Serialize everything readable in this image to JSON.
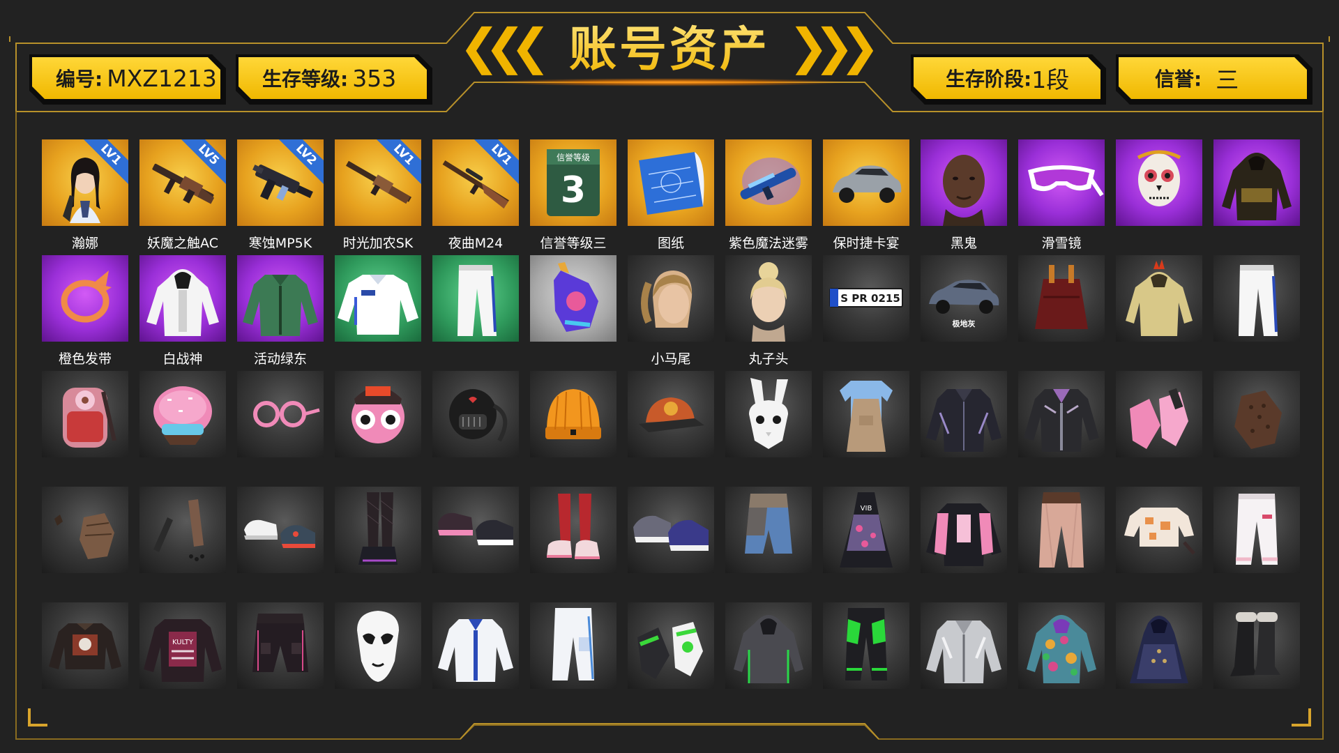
{
  "title": "账号资产",
  "badges": {
    "id": {
      "label": "编号:",
      "value": "MXZ1213"
    },
    "level": {
      "label": "生存等级:",
      "value": "353"
    },
    "stage": {
      "label": "生存阶段:",
      "value": "1段"
    },
    "honor": {
      "label": "信誉:",
      "value": "三"
    }
  },
  "rank_card": {
    "title": "信誉等级",
    "number": "3"
  },
  "plate_text": "S PR 0215",
  "car_caption": "极地灰",
  "colors": {
    "gold": "#f0b800",
    "purple": "#9a2fd8",
    "frame": "#b8912a",
    "lv_badge": "#2f6fd6"
  },
  "rows": [
    [
      {
        "label": "瀚娜",
        "lv": "LV1",
        "bg": "gold",
        "icon": "female-character-icon"
      },
      {
        "label": "妖魔之触AC",
        "lv": "LV5",
        "bg": "gold",
        "icon": "rifle-icon"
      },
      {
        "label": "寒蚀MP5K",
        "lv": "LV2",
        "bg": "gold",
        "icon": "smg-icon"
      },
      {
        "label": "时光加农SK",
        "lv": "LV1",
        "bg": "gold",
        "icon": "shotgun-rifle-icon"
      },
      {
        "label": "夜曲M24",
        "lv": "LV1",
        "bg": "gold",
        "icon": "sniper-rifle-icon"
      },
      {
        "label": "信誉等级三",
        "lv": "",
        "bg": "gold",
        "icon": "honor-rank-icon"
      },
      {
        "label": "图纸",
        "lv": "",
        "bg": "gold",
        "icon": "blueprint-icon"
      },
      {
        "label": "紫色魔法迷雾",
        "lv": "",
        "bg": "gold",
        "icon": "magic-mist-gun-icon"
      },
      {
        "label": "保时捷卡宴",
        "lv": "",
        "bg": "gold",
        "icon": "car-icon"
      },
      {
        "label": "黑鬼",
        "lv": "",
        "bg": "purple",
        "icon": "male-head-icon"
      },
      {
        "label": "滑雪镜",
        "lv": "",
        "bg": "purple",
        "icon": "ski-goggles-icon"
      },
      {
        "label": "",
        "lv": "",
        "bg": "purple",
        "icon": "skull-mask-icon"
      },
      {
        "label": "",
        "lv": "",
        "bg": "purple",
        "icon": "hooded-jacket-icon"
      }
    ],
    [
      {
        "label": "橙色发带",
        "lv": "",
        "bg": "purple",
        "icon": "headband-icon"
      },
      {
        "label": "白战神",
        "lv": "",
        "bg": "purple",
        "icon": "white-hoodie-icon"
      },
      {
        "label": "活动绿东",
        "lv": "",
        "bg": "purple",
        "icon": "green-jacket-icon"
      },
      {
        "label": "",
        "lv": "",
        "bg": "green",
        "icon": "white-shirt-icon"
      },
      {
        "label": "",
        "lv": "",
        "bg": "green",
        "icon": "white-pants-icon"
      },
      {
        "label": "",
        "lv": "",
        "bg": "gray",
        "icon": "glove-icon"
      },
      {
        "label": "小马尾",
        "lv": "",
        "bg": "dark",
        "icon": "ponytail-hair-icon"
      },
      {
        "label": "丸子头",
        "lv": "",
        "bg": "dark",
        "icon": "bun-hair-icon"
      },
      {
        "label": "",
        "lv": "",
        "bg": "dark",
        "icon": "license-plate-icon"
      },
      {
        "label": "",
        "lv": "",
        "bg": "dark",
        "icon": "suv-icon"
      },
      {
        "label": "",
        "lv": "",
        "bg": "dark",
        "icon": "red-top-icon"
      },
      {
        "label": "",
        "lv": "",
        "bg": "dark",
        "icon": "chicken-hoodie-icon"
      },
      {
        "label": "",
        "lv": "",
        "bg": "dark",
        "icon": "white-pants-icon"
      }
    ],
    [
      {
        "label": "",
        "lv": "",
        "bg": "dark",
        "icon": "donut-backpack-icon"
      },
      {
        "label": "",
        "lv": "",
        "bg": "dark",
        "icon": "donut-helmet-icon"
      },
      {
        "label": "",
        "lv": "",
        "bg": "dark",
        "icon": "pink-glasses-icon"
      },
      {
        "label": "",
        "lv": "",
        "bg": "dark",
        "icon": "donut-head-icon"
      },
      {
        "label": "",
        "lv": "",
        "bg": "dark",
        "icon": "black-mask-icon"
      },
      {
        "label": "",
        "lv": "",
        "bg": "dark",
        "icon": "orange-beanie-icon"
      },
      {
        "label": "",
        "lv": "",
        "bg": "dark",
        "icon": "cap-icon"
      },
      {
        "label": "",
        "lv": "",
        "bg": "dark",
        "icon": "rabbit-mask-icon"
      },
      {
        "label": "",
        "lv": "",
        "bg": "dark",
        "icon": "apron-icon"
      },
      {
        "label": "",
        "lv": "",
        "bg": "dark",
        "icon": "dark-jacket-icon"
      },
      {
        "label": "",
        "lv": "",
        "bg": "dark",
        "icon": "leather-jacket-icon"
      },
      {
        "label": "",
        "lv": "",
        "bg": "dark",
        "icon": "pink-gloves-icon"
      },
      {
        "label": "",
        "lv": "",
        "bg": "dark",
        "icon": "lace-glove-icon"
      }
    ],
    [
      {
        "label": "",
        "lv": "",
        "bg": "dark",
        "icon": "brown-glove-icon"
      },
      {
        "label": "",
        "lv": "",
        "bg": "dark",
        "icon": "arm-wrap-icon"
      },
      {
        "label": "",
        "lv": "",
        "bg": "dark",
        "icon": "sneakers-icon"
      },
      {
        "label": "",
        "lv": "",
        "bg": "dark",
        "icon": "stockings-boots-icon"
      },
      {
        "label": "",
        "lv": "",
        "bg": "dark",
        "icon": "pink-sneakers-icon"
      },
      {
        "label": "",
        "lv": "",
        "bg": "dark",
        "icon": "red-socks-shoes-icon"
      },
      {
        "label": "",
        "lv": "",
        "bg": "dark",
        "icon": "sport-shoes-icon"
      },
      {
        "label": "",
        "lv": "",
        "bg": "dark",
        "icon": "denim-shorts-icon"
      },
      {
        "label": "",
        "lv": "",
        "bg": "dark",
        "icon": "dress-icon"
      },
      {
        "label": "",
        "lv": "",
        "bg": "dark",
        "icon": "pink-jacket-icon"
      },
      {
        "label": "",
        "lv": "",
        "bg": "dark",
        "icon": "beige-pants-icon"
      },
      {
        "label": "",
        "lv": "",
        "bg": "dark",
        "icon": "crop-top-icon"
      },
      {
        "label": "",
        "lv": "",
        "bg": "dark",
        "icon": "white-joggers-icon"
      }
    ],
    [
      {
        "label": "",
        "lv": "",
        "bg": "dark",
        "icon": "crop-hoodie-icon"
      },
      {
        "label": "",
        "lv": "",
        "bg": "dark",
        "icon": "print-sweater-icon"
      },
      {
        "label": "",
        "lv": "",
        "bg": "dark",
        "icon": "cargo-shorts-icon"
      },
      {
        "label": "",
        "lv": "",
        "bg": "dark",
        "icon": "white-mask-icon"
      },
      {
        "label": "",
        "lv": "",
        "bg": "dark",
        "icon": "white-blue-jacket-icon"
      },
      {
        "label": "",
        "lv": "",
        "bg": "dark",
        "icon": "white-cargo-pants-icon"
      },
      {
        "label": "",
        "lv": "",
        "bg": "dark",
        "icon": "green-gloves-icon"
      },
      {
        "label": "",
        "lv": "",
        "bg": "dark",
        "icon": "gray-hoodie-icon"
      },
      {
        "label": "",
        "lv": "",
        "bg": "dark",
        "icon": "green-pants-icon"
      },
      {
        "label": "",
        "lv": "",
        "bg": "dark",
        "icon": "silver-jacket-icon"
      },
      {
        "label": "",
        "lv": "",
        "bg": "dark",
        "icon": "floral-hoodie-icon"
      },
      {
        "label": "",
        "lv": "",
        "bg": "dark",
        "icon": "navy-dress-icon"
      },
      {
        "label": "",
        "lv": "",
        "bg": "dark",
        "icon": "fur-boots-icon"
      }
    ]
  ]
}
